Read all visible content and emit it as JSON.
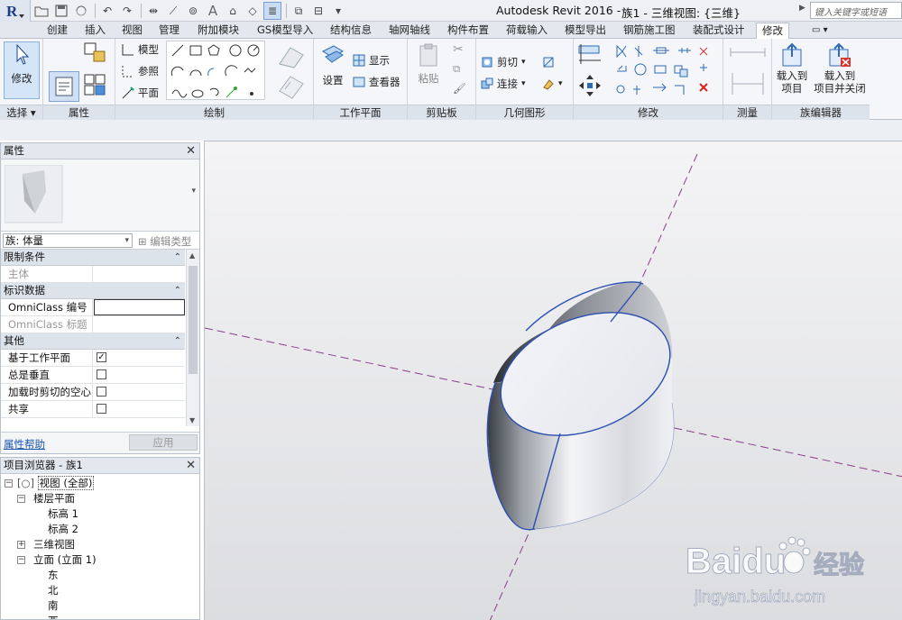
{
  "window": {
    "title": "Autodesk Revit 2016 -",
    "doc_title": "族1 - 三维视图: {三维}",
    "search_placeholder": "键入关键字或短语"
  },
  "tabs": [
    "创建",
    "插入",
    "视图",
    "管理",
    "附加模块",
    "GS模型导入",
    "结构信息",
    "轴网轴线",
    "构件布置",
    "荷载输入",
    "模型导出",
    "钢筋施工图",
    "装配式设计",
    "修改"
  ],
  "active_tab": "修改",
  "ribbon": {
    "select": {
      "label": "选择",
      "modify": "修改"
    },
    "properties": {
      "label": "属性"
    },
    "draw": {
      "label": "绘制",
      "model": "模型",
      "ref": "参照",
      "plane": "平面"
    },
    "workplane": {
      "label": "工作平面",
      "set": "设置",
      "show": "显示",
      "viewer": "查看器"
    },
    "clipboard": {
      "label": "剪贴板",
      "paste": "粘贴"
    },
    "geometry": {
      "label": "几何图形",
      "cut": "剪切",
      "join": "连接"
    },
    "modify": {
      "label": "修改"
    },
    "measure": {
      "label": "测量"
    },
    "family_editor": {
      "label": "族编辑器",
      "load": "载入到\n项目",
      "load_close": "载入到\n项目并关闭"
    }
  },
  "properties": {
    "title": "属性",
    "type_value": "族: 体量",
    "edit_type": "编辑类型",
    "sections": [
      {
        "name": "限制条件",
        "rows": [
          {
            "key": "主体",
            "dim": true
          }
        ]
      },
      {
        "name": "标识数据",
        "rows": [
          {
            "key": "OmniClass 编号",
            "input": true
          },
          {
            "key": "OmniClass 标题",
            "dim": true
          }
        ]
      },
      {
        "name": "其他",
        "rows": [
          {
            "key": "基于工作平面",
            "check": true
          },
          {
            "key": "总是垂直",
            "check": false
          },
          {
            "key": "加载时剪切的空心",
            "check": false
          },
          {
            "key": "共享",
            "check": false
          }
        ]
      }
    ],
    "help": "属性帮助",
    "apply": "应用"
  },
  "browser": {
    "title": "项目浏览器 - 族1",
    "nodes": [
      {
        "label": "视图 (全部)",
        "depth": 0,
        "box": "-"
      },
      {
        "label": "楼层平面",
        "depth": 1,
        "box": "-"
      },
      {
        "label": "标高 1",
        "depth": 2
      },
      {
        "label": "标高 2",
        "depth": 2
      },
      {
        "label": "三维视图",
        "depth": 1,
        "box": "+"
      },
      {
        "label": "立面 (立面 1)",
        "depth": 1,
        "box": "-"
      },
      {
        "label": "东",
        "depth": 2
      },
      {
        "label": "北",
        "depth": 2
      },
      {
        "label": "南",
        "depth": 2
      },
      {
        "label": "西",
        "depth": 2
      }
    ]
  },
  "watermark": {
    "brand": "Baidu",
    "brand2": "经验",
    "url": "jingyan.baidu.com"
  },
  "colors": {
    "accent": "#1a55b0",
    "selection_edge": "#2a4fb0",
    "ref_line": "#8a3d8a"
  }
}
